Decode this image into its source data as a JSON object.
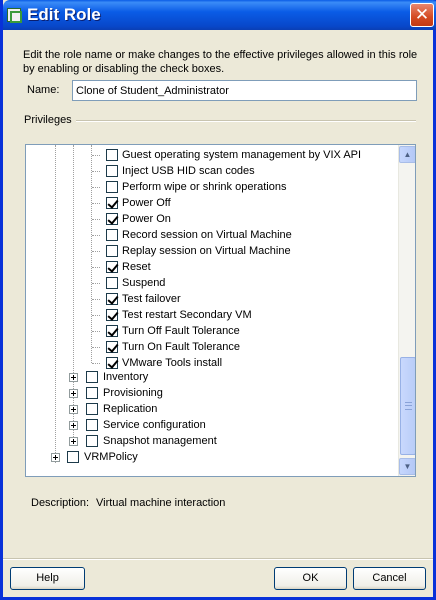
{
  "window": {
    "title": "Edit Role",
    "close_glyph": "✕"
  },
  "dialog": {
    "description_text": "Edit the role name or make changes to the effective privileges allowed in this role by enabling or disabling the check boxes.",
    "name_label": "Name:",
    "name_value": "Clone of Student_Administrator",
    "privileges_label": "Privileges",
    "description_label": "Description:",
    "description_value": "Virtual machine interaction"
  },
  "tree": {
    "leaf_items": [
      {
        "label": "Guest operating system management by VIX API",
        "checked": false
      },
      {
        "label": "Inject USB HID scan codes",
        "checked": false
      },
      {
        "label": "Perform wipe or shrink operations",
        "checked": false
      },
      {
        "label": "Power Off",
        "checked": true
      },
      {
        "label": "Power On",
        "checked": true
      },
      {
        "label": "Record session on Virtual Machine",
        "checked": false
      },
      {
        "label": "Replay session on Virtual Machine",
        "checked": false
      },
      {
        "label": "Reset",
        "checked": true
      },
      {
        "label": "Suspend",
        "checked": false
      },
      {
        "label": "Test failover",
        "checked": true
      },
      {
        "label": "Test restart Secondary VM",
        "checked": true
      },
      {
        "label": "Turn Off Fault Tolerance",
        "checked": true
      },
      {
        "label": "Turn On Fault Tolerance",
        "checked": true
      },
      {
        "label": "VMware Tools install",
        "checked": true
      }
    ],
    "group_items": [
      {
        "label": "Inventory",
        "checked": false
      },
      {
        "label": "Provisioning",
        "checked": false
      },
      {
        "label": "Replication",
        "checked": false
      },
      {
        "label": "Service configuration",
        "checked": false
      },
      {
        "label": "Snapshot management",
        "checked": false
      }
    ],
    "root_item": {
      "label": "VRMPolicy",
      "checked": false
    }
  },
  "buttons": {
    "help": "Help",
    "ok": "OK",
    "cancel": "Cancel"
  },
  "scrollbar": {
    "up_glyph": "▲",
    "down_glyph": "▼"
  },
  "colors": {
    "titlebar": "#0a5ce6",
    "close_button": "#d44a22",
    "dialog_bg": "#ece9d8"
  }
}
